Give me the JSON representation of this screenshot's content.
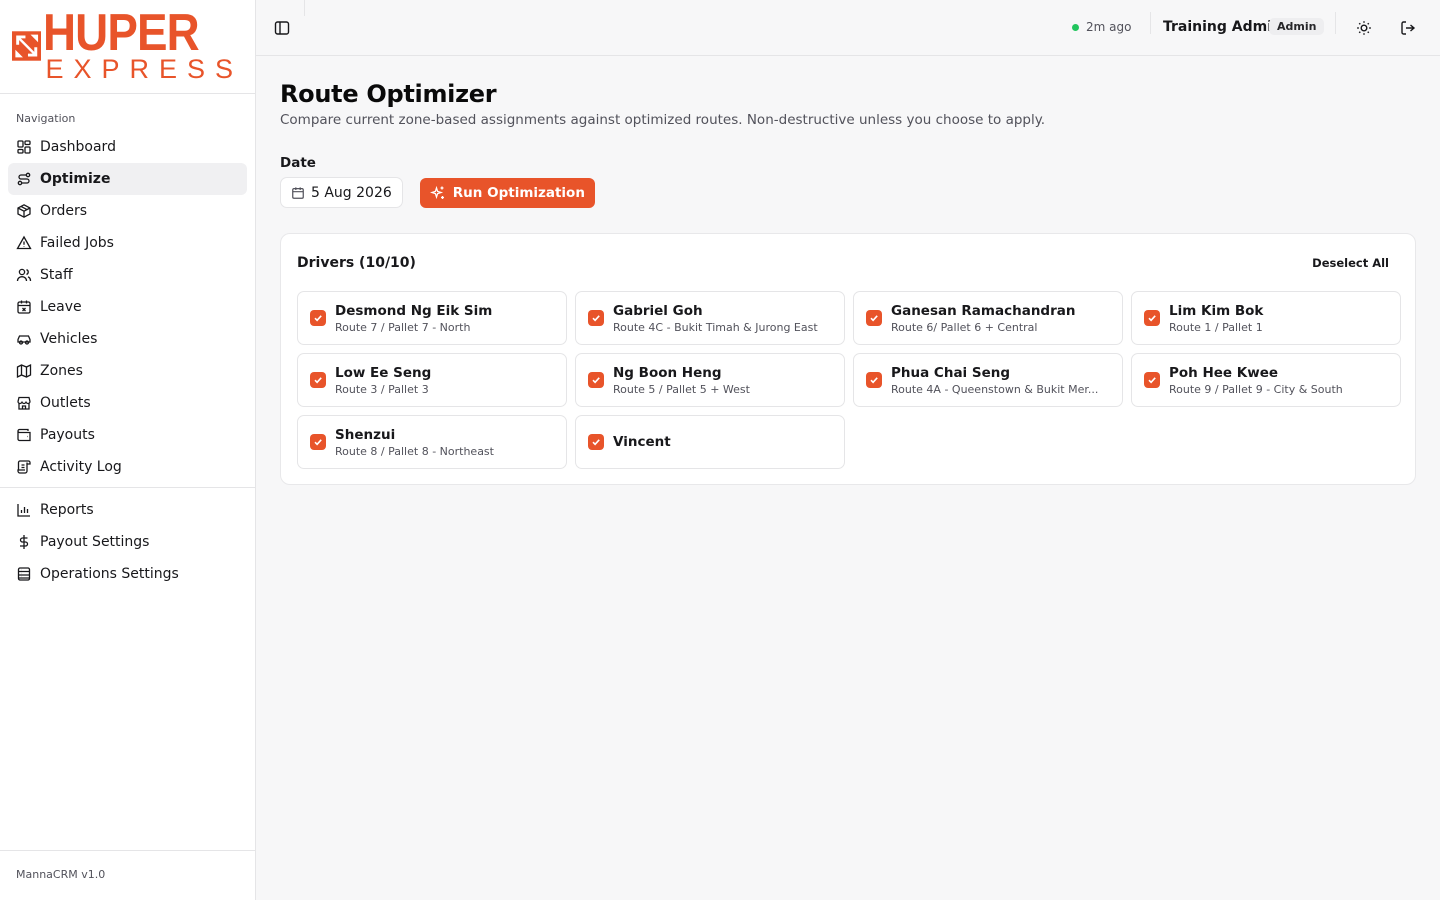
{
  "brand": {
    "name_top": "HUPER",
    "name_bottom": "EXPRESS",
    "accent": "#e8542a"
  },
  "sidebar": {
    "section_title": "Navigation",
    "items": [
      {
        "label": "Dashboard",
        "icon": "dashboard-icon"
      },
      {
        "label": "Optimize",
        "icon": "route-icon",
        "active": true
      },
      {
        "label": "Orders",
        "icon": "package-icon"
      },
      {
        "label": "Failed Jobs",
        "icon": "warning-icon"
      },
      {
        "label": "Staff",
        "icon": "users-icon"
      },
      {
        "label": "Leave",
        "icon": "calendar-x-icon"
      },
      {
        "label": "Vehicles",
        "icon": "car-icon"
      },
      {
        "label": "Zones",
        "icon": "map-icon"
      },
      {
        "label": "Outlets",
        "icon": "store-icon"
      },
      {
        "label": "Payouts",
        "icon": "wallet-icon"
      },
      {
        "label": "Activity Log",
        "icon": "scroll-icon"
      }
    ],
    "secondary_items": [
      {
        "label": "Reports",
        "icon": "bar-chart-icon"
      },
      {
        "label": "Payout Settings",
        "icon": "dollar-icon"
      },
      {
        "label": "Operations Settings",
        "icon": "database-icon"
      }
    ],
    "footer": "MannaCRM v1.0"
  },
  "header": {
    "status_text": "2m ago",
    "status_color": "#22c55e",
    "user_name": "Training Admin",
    "role": "Admin"
  },
  "page": {
    "title": "Route Optimizer",
    "subtitle": "Compare current zone-based assignments against optimized routes. Non-destructive unless you choose to apply.",
    "date_label": "Date",
    "date_value": "5 Aug 2026",
    "run_button": "Run Optimization"
  },
  "drivers": {
    "title": "Drivers (10/10)",
    "deselect_label": "Deselect All",
    "items": [
      {
        "name": "Desmond Ng Eik Sim",
        "route": "Route 7 / Pallet 7 - North",
        "checked": true
      },
      {
        "name": "Gabriel Goh",
        "route": "Route 4C - Bukit Timah & Jurong East",
        "checked": true
      },
      {
        "name": "Ganesan Ramachandran",
        "route": "Route 6/ Pallet 6 + Central",
        "checked": true
      },
      {
        "name": "Lim Kim Bok",
        "route": "Route 1 / Pallet 1",
        "checked": true
      },
      {
        "name": "Low Ee Seng",
        "route": "Route 3 / Pallet 3",
        "checked": true
      },
      {
        "name": "Ng Boon Heng",
        "route": "Route 5 / Pallet 5 + West",
        "checked": true
      },
      {
        "name": "Phua Chai Seng",
        "route": "Route 4A - Queenstown & Bukit Mer...",
        "checked": true
      },
      {
        "name": "Poh Hee Kwee",
        "route": "Route 9 / Pallet 9 - City & South",
        "checked": true
      },
      {
        "name": "Shenzui",
        "route": "Route 8 / Pallet 8 - Northeast",
        "checked": true
      },
      {
        "name": "Vincent",
        "route": "",
        "checked": true
      }
    ]
  }
}
